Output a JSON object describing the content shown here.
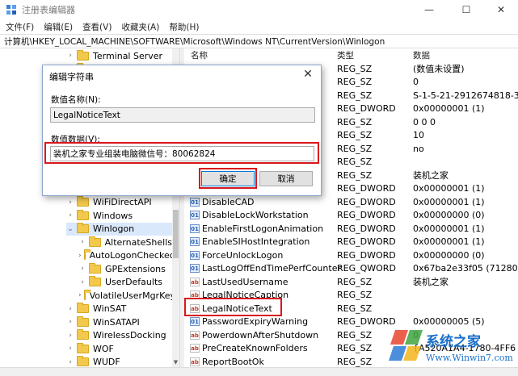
{
  "window": {
    "title": "注册表编辑器",
    "controls": {
      "minimize": "—",
      "maximize": "☐",
      "close": "✕"
    }
  },
  "menu": [
    "文件(F)",
    "编辑(E)",
    "查看(V)",
    "收藏夹(A)",
    "帮助(H)"
  ],
  "address": "计算机\\HKEY_LOCAL_MACHINE\\SOFTWARE\\Microsoft\\Windows NT\\CurrentVersion\\Winlogon",
  "tree": {
    "items": [
      {
        "label": "Terminal Server",
        "expanded": false,
        "level": 0
      },
      {
        "label": "",
        "expanded": false,
        "level": 0
      },
      {
        "label": "",
        "expanded": false,
        "level": 0
      },
      {
        "label": "",
        "expanded": false,
        "level": 0
      },
      {
        "label": "",
        "expanded": false,
        "level": 0
      },
      {
        "label": "",
        "expanded": false,
        "level": 0
      },
      {
        "label": "",
        "expanded": false,
        "level": 0
      },
      {
        "label": "",
        "expanded": false,
        "level": 0
      },
      {
        "label": "",
        "expanded": false,
        "level": 0
      },
      {
        "label": "",
        "expanded": false,
        "level": 0
      },
      {
        "label": "",
        "expanded": false,
        "level": 0
      },
      {
        "label": "WiFiDirectAPI",
        "expanded": false,
        "level": 0
      },
      {
        "label": "Windows",
        "expanded": false,
        "level": 0
      },
      {
        "label": "Winlogon",
        "expanded": true,
        "level": 0,
        "selected": true
      },
      {
        "label": "AlternateShells",
        "expanded": false,
        "level": 1
      },
      {
        "label": "AutoLogonChecked",
        "expanded": false,
        "level": 1
      },
      {
        "label": "GPExtensions",
        "expanded": false,
        "level": 1
      },
      {
        "label": "UserDefaults",
        "expanded": false,
        "level": 1
      },
      {
        "label": "VolatileUserMgrKey",
        "expanded": false,
        "level": 1
      },
      {
        "label": "WinSAT",
        "expanded": false,
        "level": 0
      },
      {
        "label": "WinSATAPI",
        "expanded": false,
        "level": 0
      },
      {
        "label": "WirelessDocking",
        "expanded": false,
        "level": 0
      },
      {
        "label": "WOF",
        "expanded": false,
        "level": 0
      },
      {
        "label": "WUDF",
        "expanded": false,
        "level": 0
      }
    ]
  },
  "list": {
    "headers": {
      "name": "名称",
      "type": "类型",
      "data": "数据"
    },
    "rows": [
      {
        "icon": "ab",
        "name": "",
        "type": "REG_SZ",
        "data": "(数值未设置)"
      },
      {
        "icon": "ab",
        "name": "",
        "type": "REG_SZ",
        "data": "0"
      },
      {
        "icon": "ab",
        "name": "",
        "type": "REG_SZ",
        "data": "S-1-5-21-2912674818-3"
      },
      {
        "icon": "bin",
        "name": "",
        "type": "REG_DWORD",
        "data": "0x00000001 (1)"
      },
      {
        "icon": "ab",
        "name": "",
        "type": "REG_SZ",
        "data": "0 0 0"
      },
      {
        "icon": "ab",
        "name": "",
        "type": "REG_SZ",
        "data": "10"
      },
      {
        "icon": "ab",
        "name": "",
        "type": "REG_SZ",
        "data": "no"
      },
      {
        "icon": "ab",
        "name": "",
        "type": "REG_SZ",
        "data": ""
      },
      {
        "icon": "ab",
        "name": "",
        "type": "REG_SZ",
        "data": "装机之家"
      },
      {
        "icon": "bin",
        "name": "",
        "type": "REG_DWORD",
        "data": "0x00000001 (1)"
      },
      {
        "icon": "bin",
        "name": "DisableCAD",
        "type": "REG_DWORD",
        "data": "0x00000001 (1)"
      },
      {
        "icon": "bin",
        "name": "DisableLockWorkstation",
        "type": "REG_DWORD",
        "data": "0x00000000 (0)"
      },
      {
        "icon": "bin",
        "name": "EnableFirstLogonAnimation",
        "type": "REG_DWORD",
        "data": "0x00000001 (1)"
      },
      {
        "icon": "bin",
        "name": "EnableSIHostIntegration",
        "type": "REG_DWORD",
        "data": "0x00000001 (1)"
      },
      {
        "icon": "bin",
        "name": "ForceUnlockLogon",
        "type": "REG_DWORD",
        "data": "0x00000000 (0)"
      },
      {
        "icon": "bin",
        "name": "LastLogOffEndTimePerfCounter",
        "type": "REG_QWORD",
        "data": "0x67ba2e33f05 (712808"
      },
      {
        "icon": "ab",
        "name": "LastUsedUsername",
        "type": "REG_SZ",
        "data": "装机之家"
      },
      {
        "icon": "ab",
        "name": "LegalNoticeCaption",
        "type": "REG_SZ",
        "data": ""
      },
      {
        "icon": "ab",
        "name": "LegalNoticeText",
        "type": "REG_SZ",
        "data": ""
      },
      {
        "icon": "bin",
        "name": "PasswordExpiryWarning",
        "type": "REG_DWORD",
        "data": "0x00000005 (5)"
      },
      {
        "icon": "ab",
        "name": "PowerdownAfterShutdown",
        "type": "REG_SZ",
        "data": "0"
      },
      {
        "icon": "ab",
        "name": "PreCreateKnownFolders",
        "type": "REG_SZ",
        "data": "{A520A1A4-1780-4FF6"
      },
      {
        "icon": "ab",
        "name": "ReportBootOk",
        "type": "REG_SZ",
        "data": ""
      }
    ]
  },
  "dialog": {
    "title": "编辑字符串",
    "close": "✕",
    "name_label": "数值名称(N):",
    "name_value": "LegalNoticeText",
    "data_label": "数值数据(V):",
    "data_value": "装机之家专业组装电脑微信号：80062824",
    "ok": "确定",
    "cancel": "取消"
  },
  "watermark": {
    "brand": "系统之家",
    "url": "Www.Winwin7.com"
  },
  "colors": {
    "highlight": "#d9161d",
    "accent": "#0078d7",
    "folder": "#f2c94c"
  }
}
